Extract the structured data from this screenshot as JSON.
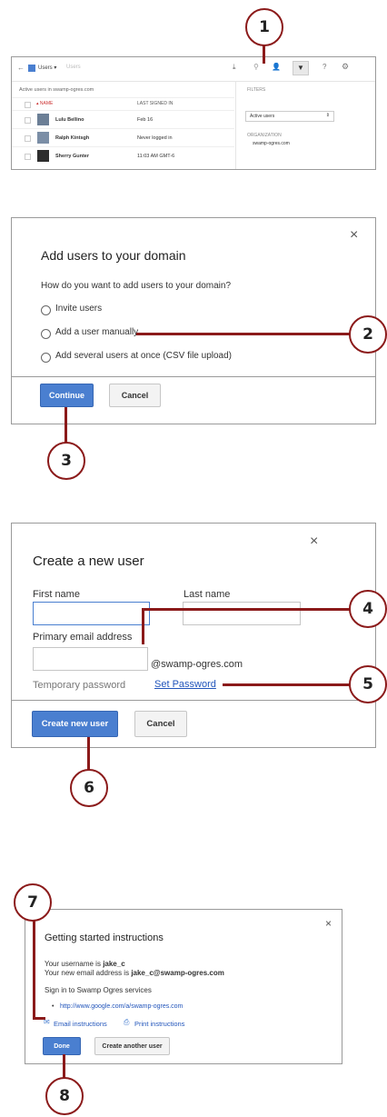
{
  "callouts": {
    "c1": "1",
    "c2": "2",
    "c3": "3",
    "c4": "4",
    "c5": "5",
    "c6": "6",
    "c7": "7",
    "c8": "8"
  },
  "users_panel": {
    "app_menu": "Users ▾",
    "search_placeholder": "Users",
    "list_header": "Active users in swamp-ogres.com",
    "col_name": "▴ NAME",
    "col_last_signed_in": "LAST SIGNED IN",
    "rows": [
      {
        "name": "Lulu Bellino",
        "last": "Feb 16"
      },
      {
        "name": "Ralph Kintsgh",
        "last": "Never logged in"
      },
      {
        "name": "Sherry Gunter",
        "last": "11:03 AM GMT-6"
      }
    ],
    "filters_label": "FILTERS",
    "filter_value": "Active users",
    "org_label": "ORGANIZATION",
    "org_value": "swamp-ogres.com"
  },
  "add_users_dialog": {
    "title": "Add users to your domain",
    "question": "How do you want to add users to your domain?",
    "options": [
      "Invite users",
      "Add a user manually",
      "Add several users at once (CSV file upload)"
    ],
    "continue_label": "Continue",
    "cancel_label": "Cancel",
    "close_glyph": "×"
  },
  "create_user_dialog": {
    "title": "Create a new user",
    "first_name_label": "First name",
    "last_name_label": "Last name",
    "email_label": "Primary email address",
    "domain_suffix": "@swamp-ogres.com",
    "temp_password_label": "Temporary password",
    "set_password_link": "Set Password",
    "create_label": "Create new user",
    "cancel_label": "Cancel",
    "close_glyph": "×"
  },
  "instructions_dialog": {
    "title": "Getting started instructions",
    "username_prefix": "Your username is ",
    "username": "jake_c",
    "email_prefix": "Your new email address is ",
    "email": "jake_c@swamp-ogres.com",
    "signin_text": "Sign in to Swamp Ogres services",
    "signin_url": "http://www.google.com/a/swamp-ogres.com",
    "email_instructions": "Email instructions",
    "print_instructions": "Print instructions",
    "done_label": "Done",
    "create_another_label": "Create another user",
    "close_glyph": "×"
  }
}
